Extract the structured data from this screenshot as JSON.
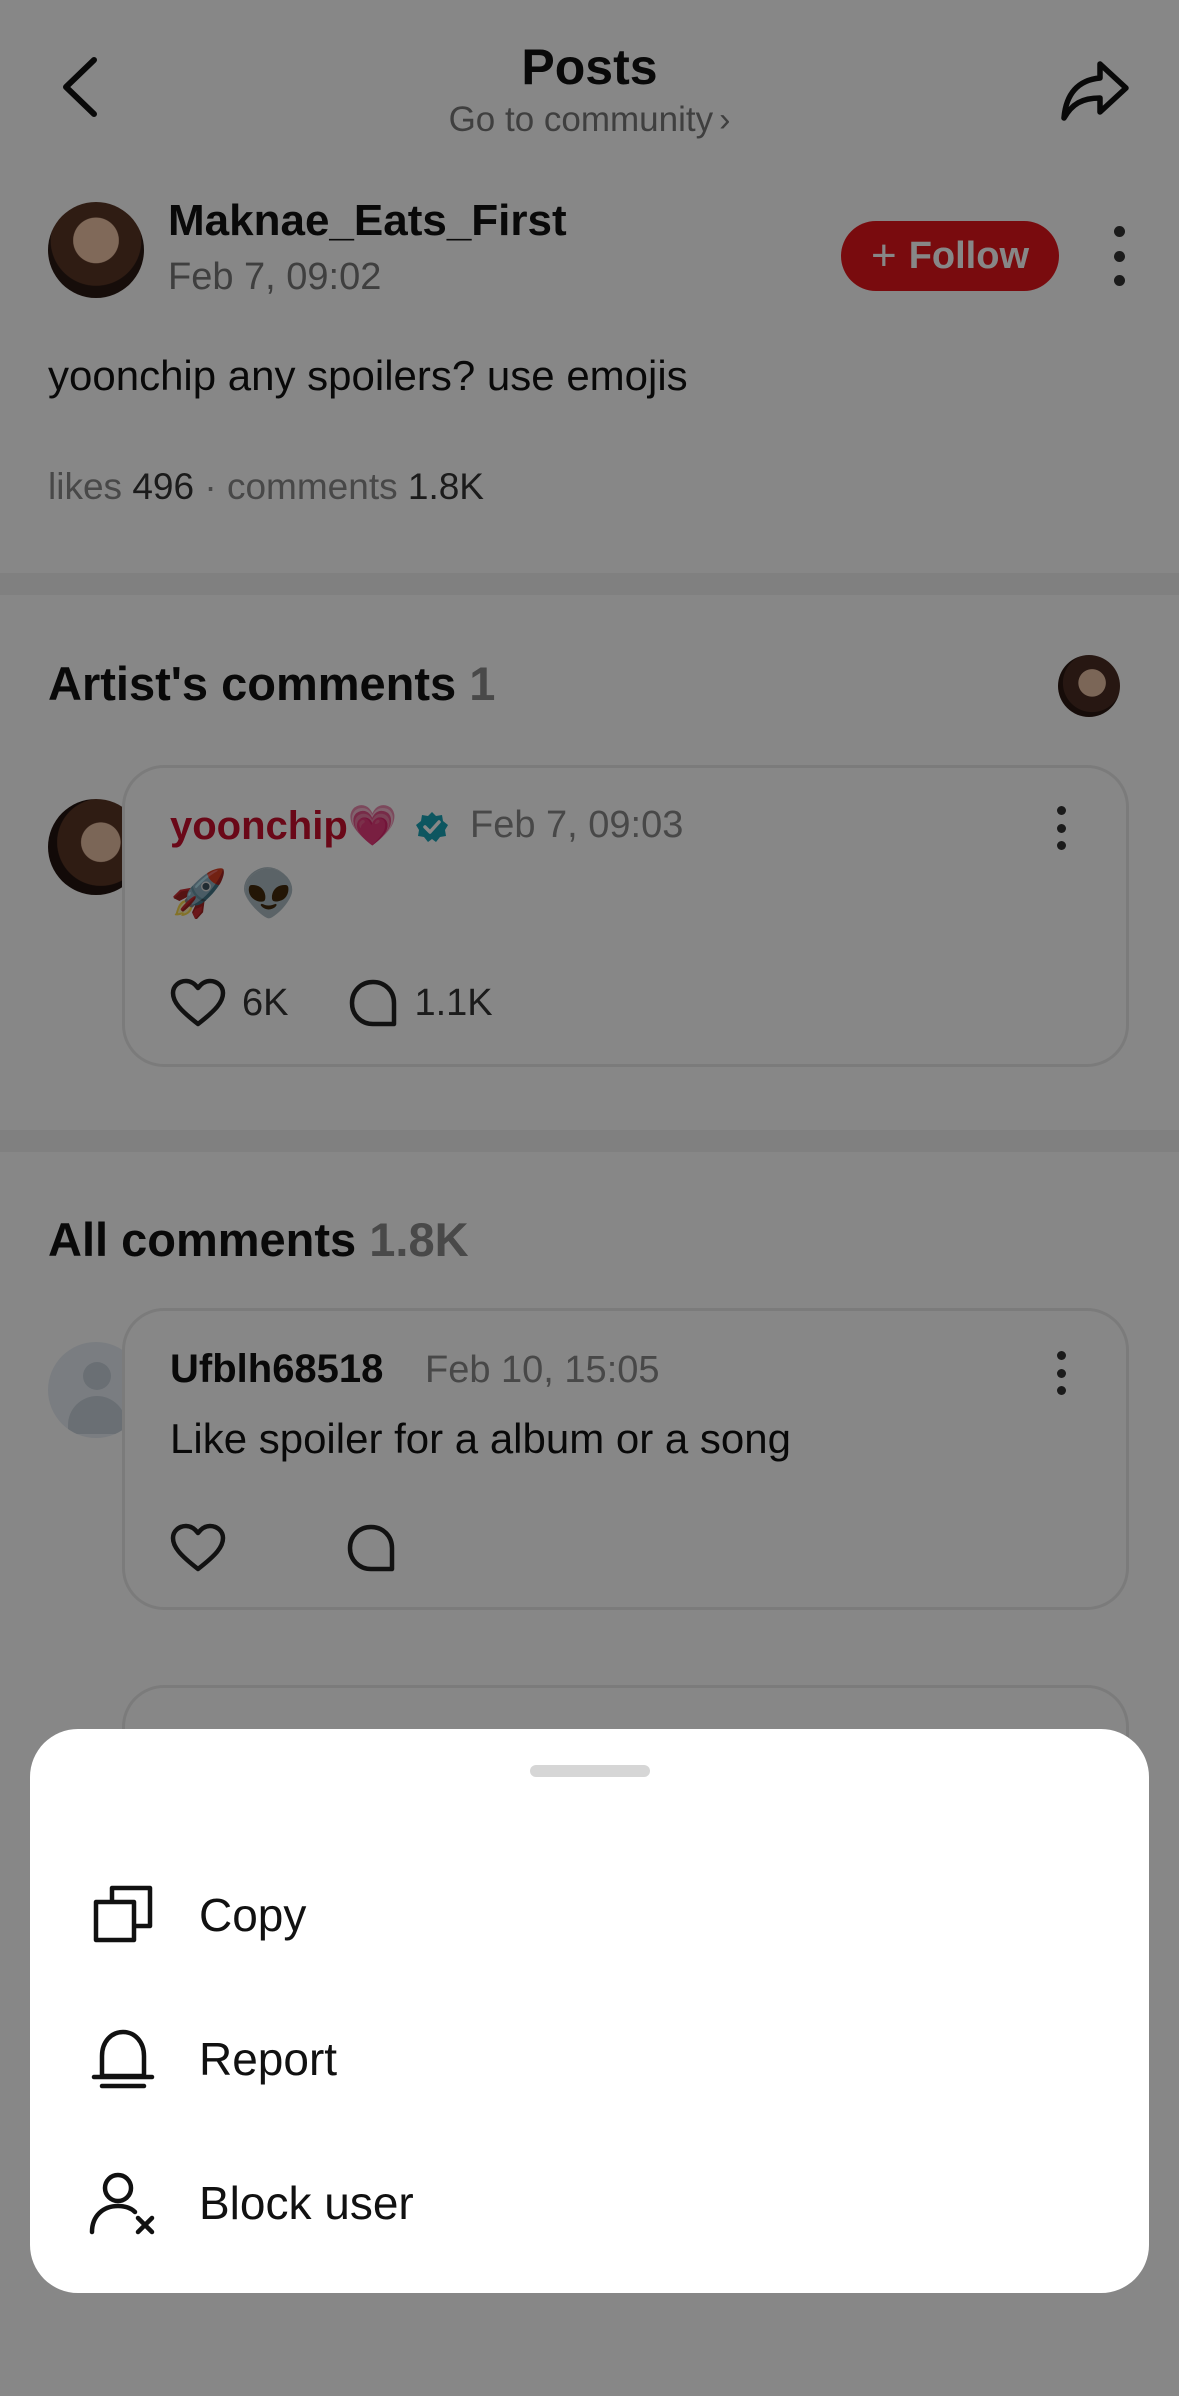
{
  "header": {
    "title": "Posts",
    "subtitle": "Go to community",
    "subtitle_chevron": "›"
  },
  "post": {
    "author": "Maknae_Eats_First",
    "time": "Feb 7, 09:02",
    "follow_label": "Follow",
    "follow_plus": "+",
    "body": "yoonchip any spoilers? use emojis",
    "likes_label": "likes",
    "likes_value": "496",
    "separator": "·",
    "comments_label": "comments",
    "comments_value": "1.8K"
  },
  "artist_section": {
    "title": "Artist's comments",
    "count": "1",
    "comment": {
      "name": "yoonchip",
      "name_emoji": "💗",
      "time": "Feb 7, 09:03",
      "text": "🚀 👽",
      "likes": "6K",
      "replies": "1.1K"
    }
  },
  "all_section": {
    "title": "All comments",
    "count": "1.8K",
    "comments": [
      {
        "name": "Ufblh68518",
        "time": "Feb 10, 15:05",
        "text": "Like spoiler for a album or a song"
      }
    ]
  },
  "sheet": {
    "items": [
      {
        "label": "Copy",
        "icon": "copy-icon"
      },
      {
        "label": "Report",
        "icon": "bell-icon"
      },
      {
        "label": "Block user",
        "icon": "block-user-icon"
      }
    ]
  },
  "colors": {
    "accent": "#e5161c",
    "artist_name": "#c8102e",
    "verified": "#1aa3b5"
  }
}
